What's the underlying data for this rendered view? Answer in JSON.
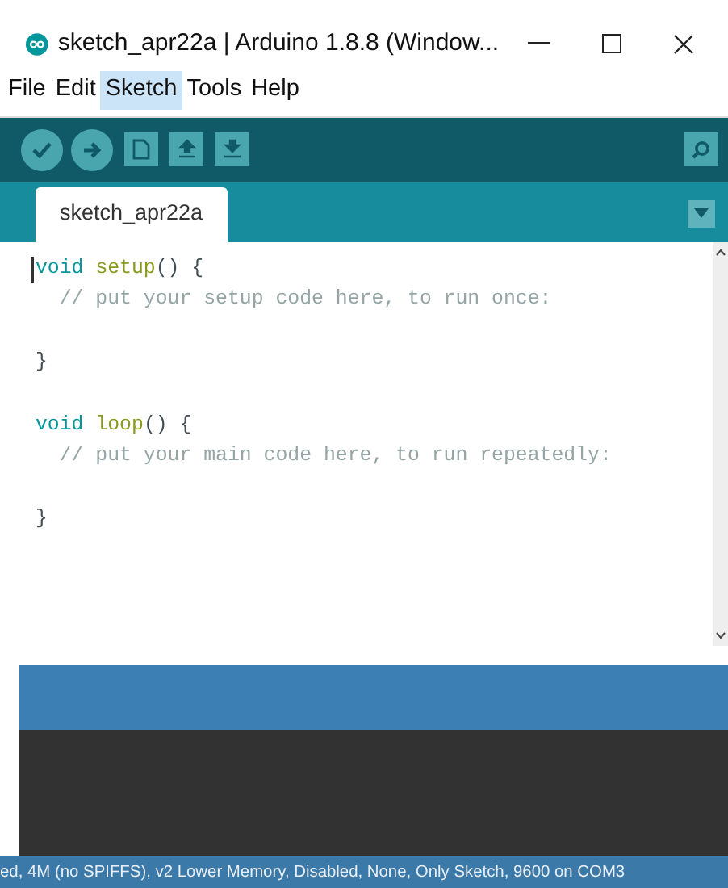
{
  "window": {
    "title": "sketch_apr22a | Arduino 1.8.8 (Window..."
  },
  "menu": [
    {
      "label": "File",
      "selected": false
    },
    {
      "label": "Edit",
      "selected": false
    },
    {
      "label": "Sketch",
      "selected": true
    },
    {
      "label": "Tools",
      "selected": false
    },
    {
      "label": "Help",
      "selected": false
    }
  ],
  "tabs": [
    {
      "label": "sketch_apr22a",
      "selected": true
    }
  ],
  "editor": {
    "lines": [
      {
        "kind": "code",
        "tokens": [
          {
            "kind": "keyword",
            "text": "void "
          },
          {
            "kind": "function",
            "text": "setup"
          },
          {
            "kind": "plain",
            "text": "() {"
          }
        ]
      },
      {
        "kind": "code",
        "tokens": [
          {
            "kind": "comment",
            "text": "  // put your setup code here, to run once:"
          }
        ]
      },
      {
        "kind": "blank"
      },
      {
        "kind": "code",
        "tokens": [
          {
            "kind": "plain",
            "text": "}"
          }
        ]
      },
      {
        "kind": "blank"
      },
      {
        "kind": "code",
        "tokens": [
          {
            "kind": "keyword",
            "text": "void "
          },
          {
            "kind": "function",
            "text": "loop"
          },
          {
            "kind": "plain",
            "text": "() {"
          }
        ]
      },
      {
        "kind": "code",
        "tokens": [
          {
            "kind": "comment",
            "text": "  // put your main code here, to run repeatedly:"
          }
        ]
      },
      {
        "kind": "blank"
      },
      {
        "kind": "code",
        "tokens": [
          {
            "kind": "plain",
            "text": "}"
          }
        ]
      }
    ]
  },
  "status_bar": {
    "text": "ed, 4M (no SPIFFS), v2 Lower Memory, Disabled, None, Only Sketch, 9600 on COM3"
  }
}
